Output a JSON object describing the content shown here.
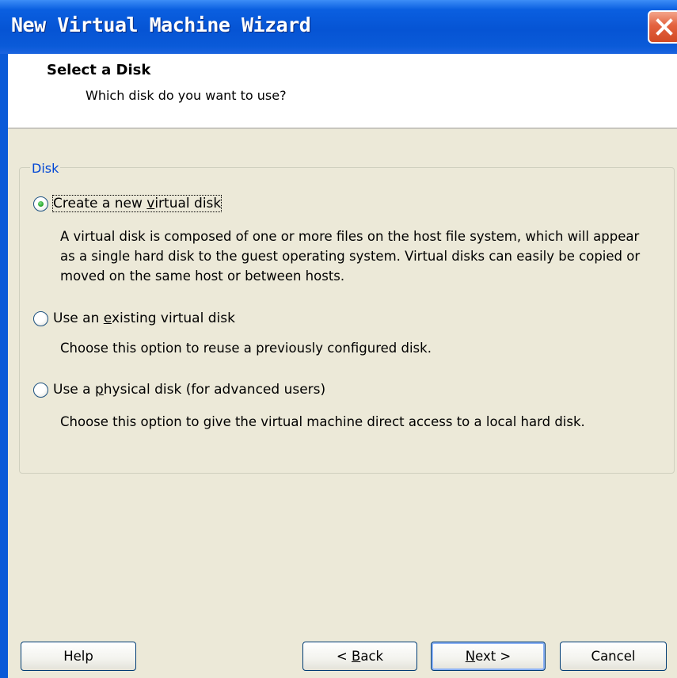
{
  "window": {
    "title": "New Virtual Machine Wizard",
    "close_icon": "close-icon"
  },
  "header": {
    "title": "Select a Disk",
    "subtitle": "Which disk do you want to use?"
  },
  "group": {
    "legend": "Disk",
    "options": [
      {
        "label_pre": "Create a new ",
        "label_mnemonic": "v",
        "label_post": "irtual disk",
        "selected": true,
        "description": "A virtual disk is composed of one or more files on the host file system, which will appear as a single hard disk to the guest operating system. Virtual disks can easily be copied or moved on the same host or between hosts."
      },
      {
        "label_pre": "Use an ",
        "label_mnemonic": "e",
        "label_post": "xisting virtual disk",
        "selected": false,
        "description": "Choose this option to reuse a previously configured disk."
      },
      {
        "label_pre": "Use a ",
        "label_mnemonic": "p",
        "label_post": "hysical disk (for advanced users)",
        "selected": false,
        "description": "Choose this option to give the virtual machine direct access to a local hard disk."
      }
    ]
  },
  "buttons": {
    "help": "Help",
    "back_pre": "< ",
    "back_mnemonic": "B",
    "back_post": "ack",
    "next_mnemonic": "N",
    "next_post": "ext >",
    "cancel": "Cancel"
  }
}
